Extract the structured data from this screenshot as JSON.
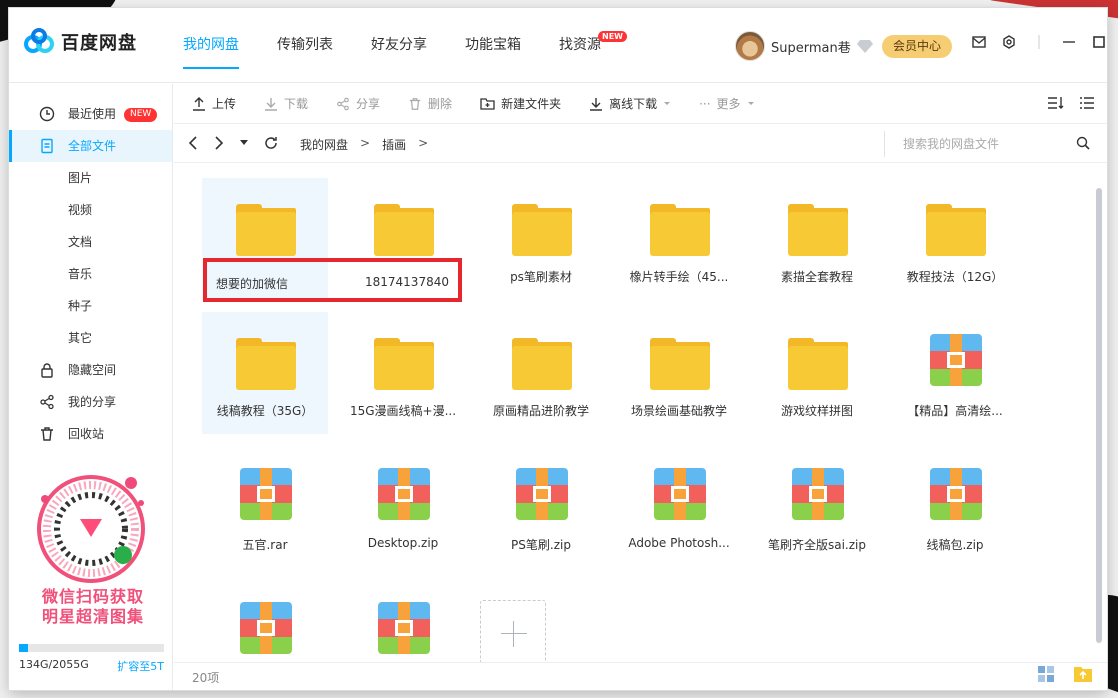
{
  "app": {
    "logo_text": "百度网盘"
  },
  "nav": [
    {
      "label": "我的网盘",
      "active": true
    },
    {
      "label": "传输列表"
    },
    {
      "label": "好友分享"
    },
    {
      "label": "功能宝箱"
    },
    {
      "label": "找资源",
      "badge": "NEW"
    }
  ],
  "user": {
    "name": "Superman巷",
    "vip_button": "会员中心"
  },
  "sidebar": {
    "items": [
      {
        "label": "最近使用",
        "badge": "NEW",
        "icon": "clock-icon"
      },
      {
        "label": "全部文件",
        "active": true,
        "icon": "file-icon"
      },
      {
        "label": "图片"
      },
      {
        "label": "视频"
      },
      {
        "label": "文档"
      },
      {
        "label": "音乐"
      },
      {
        "label": "种子"
      },
      {
        "label": "其它"
      },
      {
        "label": "隐藏空间",
        "icon": "lock-icon"
      },
      {
        "label": "我的分享",
        "icon": "share-icon"
      },
      {
        "label": "回收站",
        "icon": "trash-icon"
      }
    ],
    "promo_line1": "微信扫码获取",
    "promo_line2": "明星超清图集",
    "storage_text": "134G/2055G",
    "storage_used_fraction": 0.065,
    "expand_label": "扩容至5T"
  },
  "toolbar": {
    "upload": "上传",
    "download": "下载",
    "share": "分享",
    "delete": "删除",
    "new_folder": "新建文件夹",
    "offline": "离线下载",
    "more": "更多"
  },
  "breadcrumb": {
    "root": "我的网盘",
    "folder": "插画",
    "sep": ">"
  },
  "search": {
    "placeholder": "搜索我的网盘文件"
  },
  "files": [
    {
      "name": "",
      "type": "folder"
    },
    {
      "name": "",
      "type": "folder"
    },
    {
      "name": "ps笔刷素材",
      "type": "folder"
    },
    {
      "name": "橡片转手绘（45...",
      "type": "folder"
    },
    {
      "name": "素描全套教程",
      "type": "folder"
    },
    {
      "name": "教程技法（12G）",
      "type": "folder"
    },
    {
      "name": "线稿教程（35G）",
      "type": "folder"
    },
    {
      "name": "15G漫画线稿+漫...",
      "type": "folder"
    },
    {
      "name": "原画精品进阶教学",
      "type": "folder"
    },
    {
      "name": "场景绘画基础教学",
      "type": "folder"
    },
    {
      "name": "游戏纹样拼图",
      "type": "folder"
    },
    {
      "name": "【精品】高清绘...",
      "type": "zip"
    },
    {
      "name": "五官.rar",
      "type": "zip"
    },
    {
      "name": "Desktop.zip",
      "type": "zip"
    },
    {
      "name": "PS笔刷.zip",
      "type": "zip"
    },
    {
      "name": "Adobe Photosh...",
      "type": "zip"
    },
    {
      "name": "笔刷齐全版sai.zip",
      "type": "zip"
    },
    {
      "name": "线稿包.zip",
      "type": "zip"
    },
    {
      "name": "",
      "type": "zip"
    },
    {
      "name": "",
      "type": "zip"
    }
  ],
  "overlay": {
    "left_text": "想要的加微信",
    "right_text": "18174137840"
  },
  "status": {
    "count": "20项"
  },
  "colors": {
    "accent": "#06a7ff",
    "highlight": "#e6272d",
    "folder": "#f7c935",
    "vip": "#f7cd73"
  }
}
